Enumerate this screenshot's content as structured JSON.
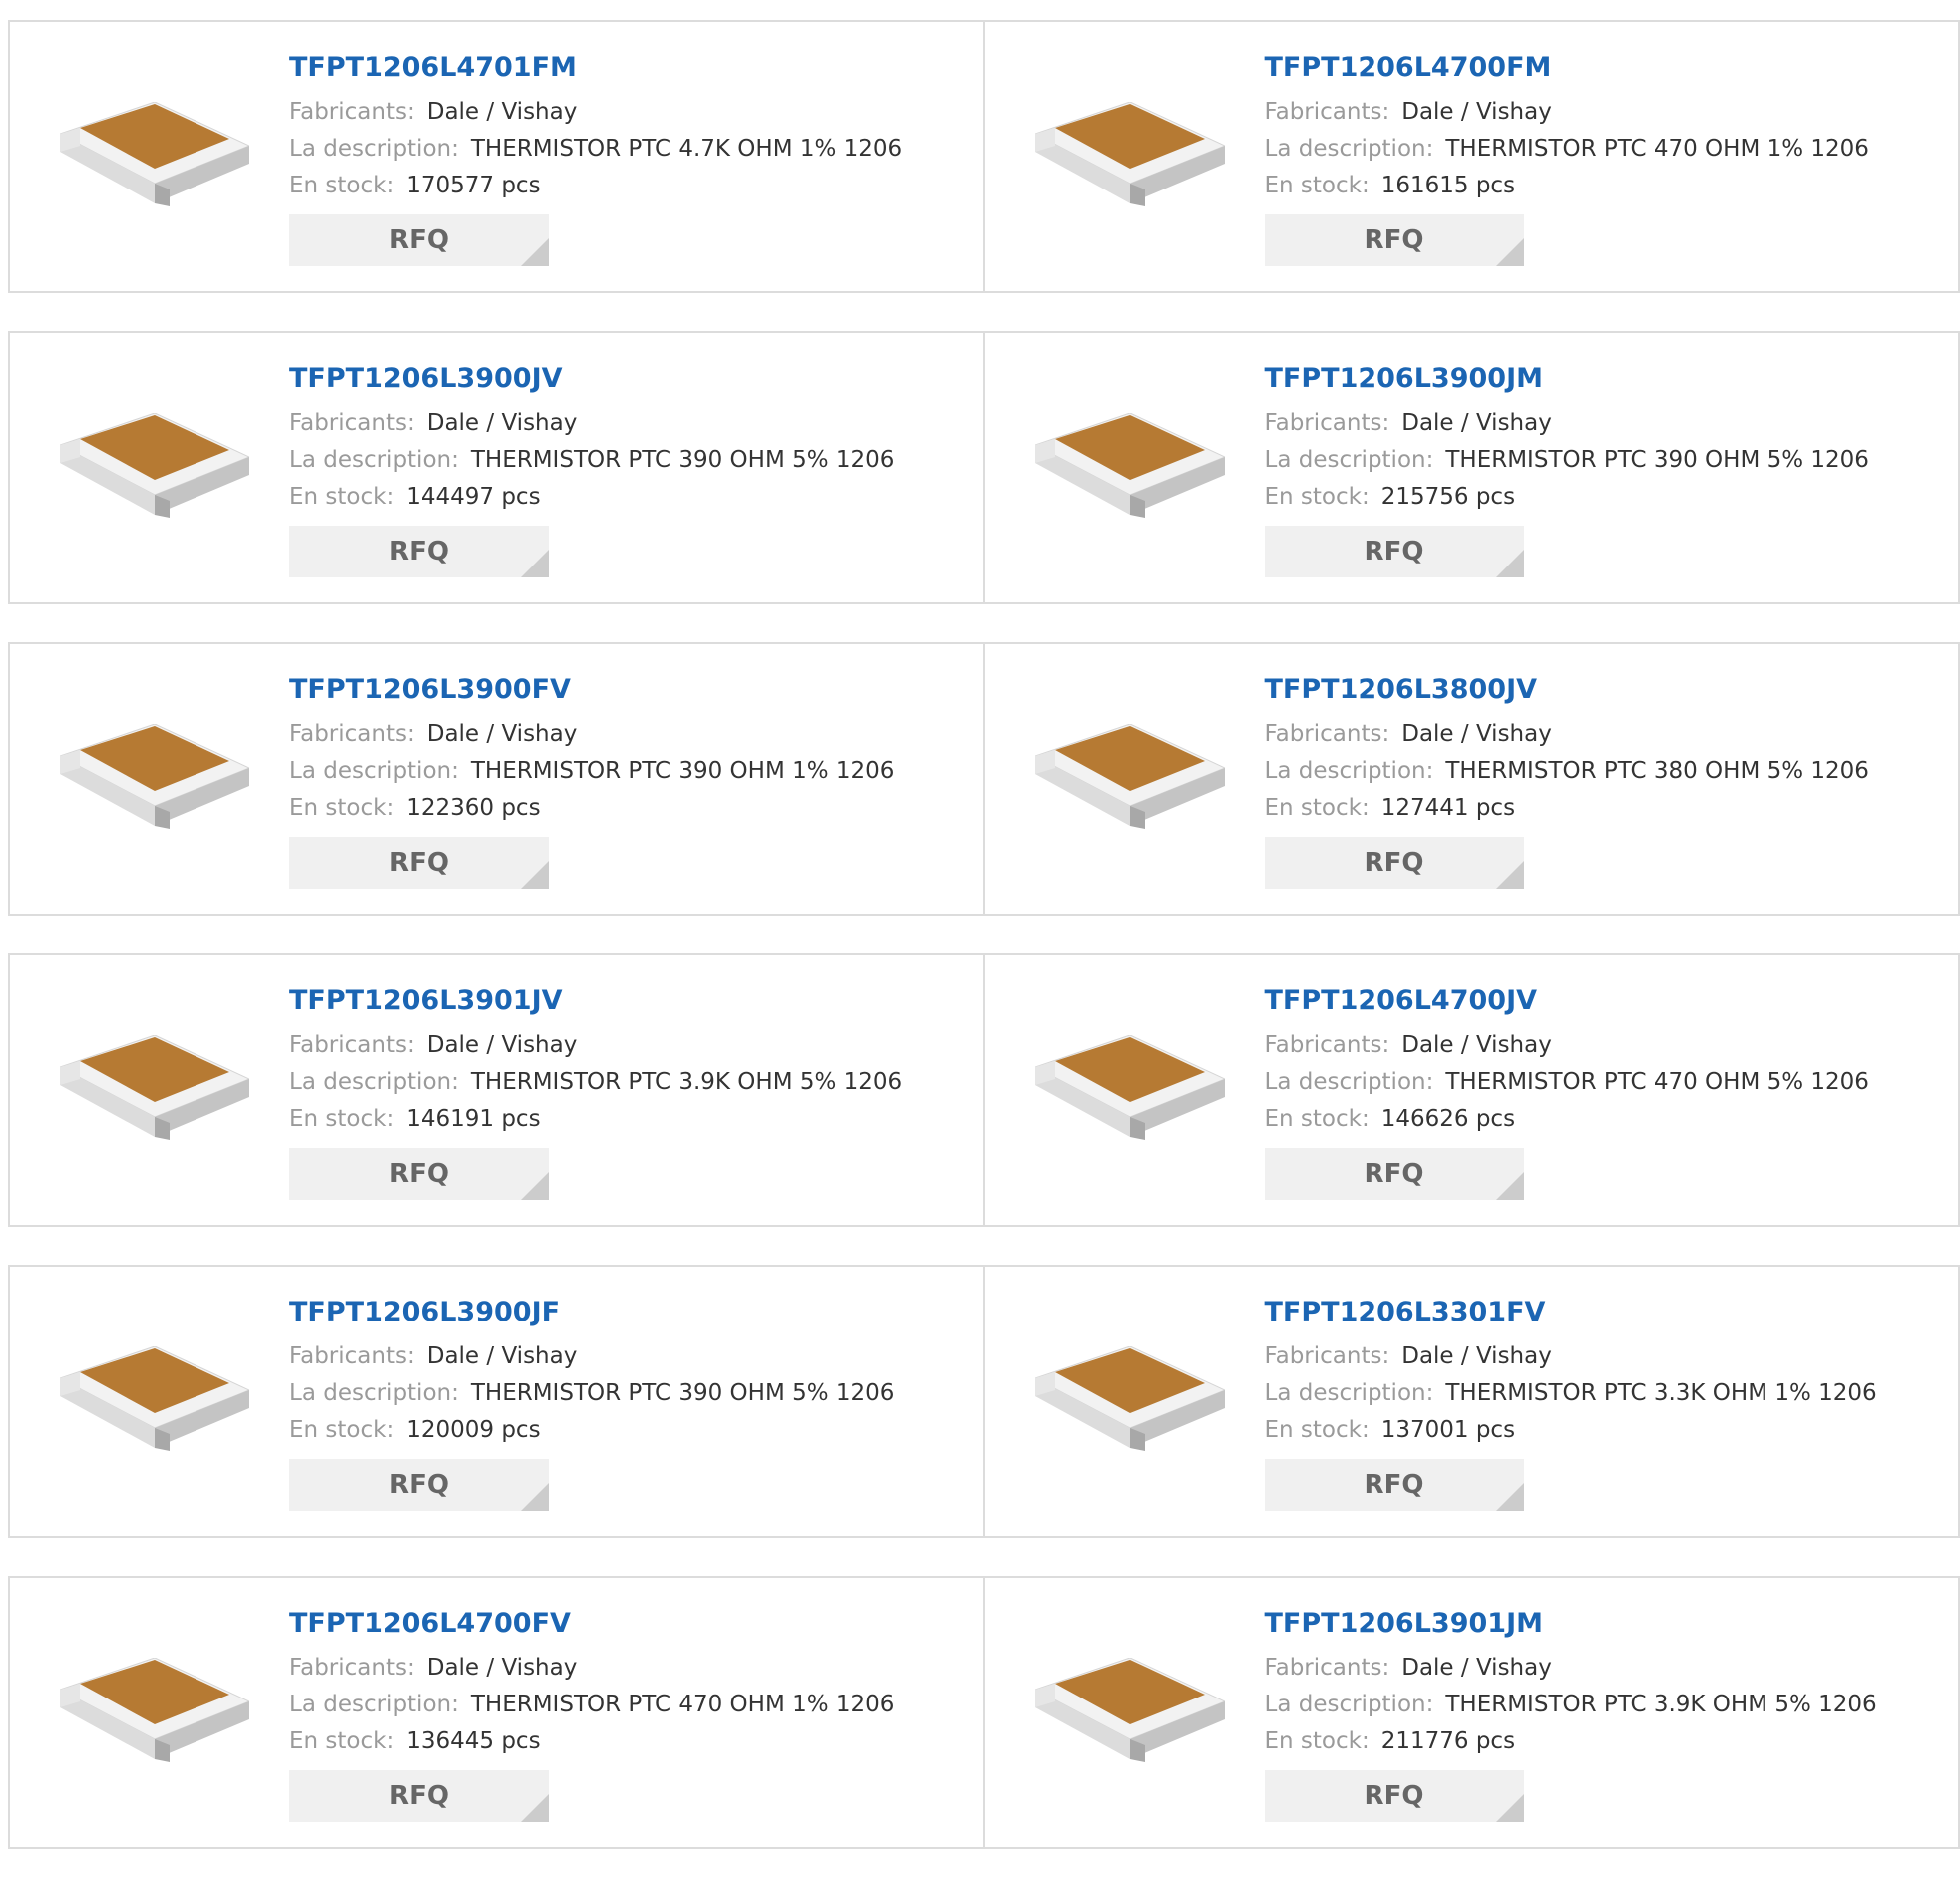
{
  "labels": {
    "manufacturer": "Fabricants:",
    "description": "La description:",
    "stock": "En stock:",
    "rfq": "RFQ"
  },
  "colors": {
    "link": "#1b65b3",
    "label": "#9a9a9a",
    "value": "#333333",
    "button_bg": "#f0f0f0",
    "border": "#dcdcdc"
  },
  "thumbnail_icon": "smd-chip-resistor-icon",
  "products": [
    {
      "part": "TFPT1206L4701FM",
      "manufacturer": "Dale / Vishay",
      "description": "THERMISTOR PTC 4.7K OHM 1% 1206",
      "stock": "170577 pcs"
    },
    {
      "part": "TFPT1206L4700FM",
      "manufacturer": "Dale / Vishay",
      "description": "THERMISTOR PTC 470 OHM 1% 1206",
      "stock": "161615 pcs"
    },
    {
      "part": "TFPT1206L3900JV",
      "manufacturer": "Dale / Vishay",
      "description": "THERMISTOR PTC 390 OHM 5% 1206",
      "stock": "144497 pcs"
    },
    {
      "part": "TFPT1206L3900JM",
      "manufacturer": "Dale / Vishay",
      "description": "THERMISTOR PTC 390 OHM 5% 1206",
      "stock": "215756 pcs"
    },
    {
      "part": "TFPT1206L3900FV",
      "manufacturer": "Dale / Vishay",
      "description": "THERMISTOR PTC 390 OHM 1% 1206",
      "stock": "122360 pcs"
    },
    {
      "part": "TFPT1206L3800JV",
      "manufacturer": "Dale / Vishay",
      "description": "THERMISTOR PTC 380 OHM 5% 1206",
      "stock": "127441 pcs"
    },
    {
      "part": "TFPT1206L3901JV",
      "manufacturer": "Dale / Vishay",
      "description": "THERMISTOR PTC 3.9K OHM 5% 1206",
      "stock": "146191 pcs"
    },
    {
      "part": "TFPT1206L4700JV",
      "manufacturer": "Dale / Vishay",
      "description": "THERMISTOR PTC 470 OHM 5% 1206",
      "stock": "146626 pcs"
    },
    {
      "part": "TFPT1206L3900JF",
      "manufacturer": "Dale / Vishay",
      "description": "THERMISTOR PTC 390 OHM 5% 1206",
      "stock": "120009 pcs"
    },
    {
      "part": "TFPT1206L3301FV",
      "manufacturer": "Dale / Vishay",
      "description": "THERMISTOR PTC 3.3K OHM 1% 1206",
      "stock": "137001 pcs"
    },
    {
      "part": "TFPT1206L4700FV",
      "manufacturer": "Dale / Vishay",
      "description": "THERMISTOR PTC 470 OHM 1% 1206",
      "stock": "136445 pcs"
    },
    {
      "part": "TFPT1206L3901JM",
      "manufacturer": "Dale / Vishay",
      "description": "THERMISTOR PTC 3.9K OHM 5% 1206",
      "stock": "211776 pcs"
    }
  ]
}
